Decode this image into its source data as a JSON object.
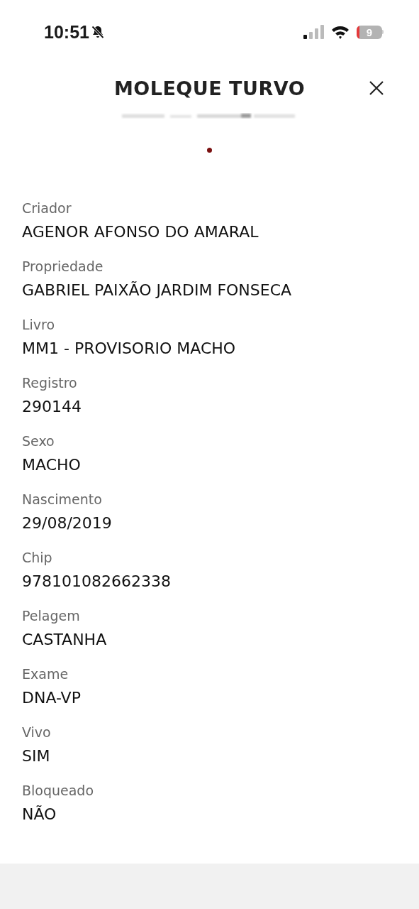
{
  "status_bar": {
    "time": "10:51",
    "battery": "9"
  },
  "header": {
    "title": "MOLEQUE TURVO"
  },
  "pager": {
    "dots": [
      {
        "selected": true
      }
    ]
  },
  "fields": [
    {
      "label": "Criador",
      "value": "AGENOR AFONSO DO AMARAL"
    },
    {
      "label": "Propriedade",
      "value": "GABRIEL PAIXÃO JARDIM FONSECA"
    },
    {
      "label": "Livro",
      "value": "MM1 - PROVISORIO MACHO"
    },
    {
      "label": "Registro",
      "value": "290144"
    },
    {
      "label": "Sexo",
      "value": "MACHO"
    },
    {
      "label": "Nascimento",
      "value": "29/08/2019"
    },
    {
      "label": "Chip",
      "value": "978101082662338"
    },
    {
      "label": "Pelagem",
      "value": "CASTANHA"
    },
    {
      "label": "Exame",
      "value": "DNA-VP"
    },
    {
      "label": "Vivo",
      "value": "SIM"
    },
    {
      "label": "Bloqueado",
      "value": "NÃO"
    }
  ]
}
